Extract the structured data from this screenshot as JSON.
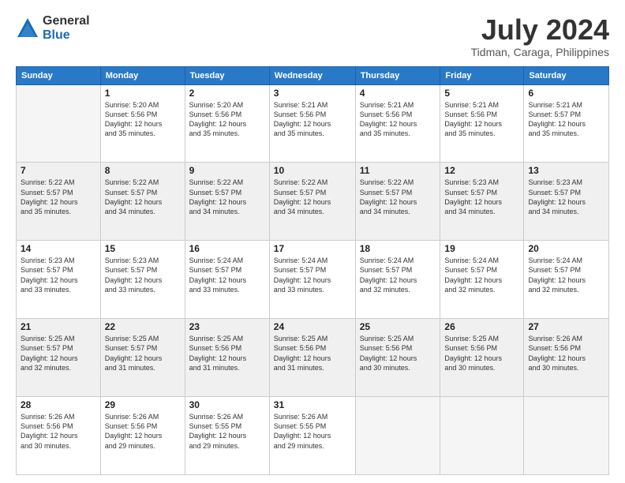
{
  "logo": {
    "general": "General",
    "blue": "Blue"
  },
  "title": "July 2024",
  "location": "Tidman, Caraga, Philippines",
  "days_of_week": [
    "Sunday",
    "Monday",
    "Tuesday",
    "Wednesday",
    "Thursday",
    "Friday",
    "Saturday"
  ],
  "weeks": [
    [
      {
        "day": "",
        "info": ""
      },
      {
        "day": "1",
        "info": "Sunrise: 5:20 AM\nSunset: 5:56 PM\nDaylight: 12 hours\nand 35 minutes."
      },
      {
        "day": "2",
        "info": "Sunrise: 5:20 AM\nSunset: 5:56 PM\nDaylight: 12 hours\nand 35 minutes."
      },
      {
        "day": "3",
        "info": "Sunrise: 5:21 AM\nSunset: 5:56 PM\nDaylight: 12 hours\nand 35 minutes."
      },
      {
        "day": "4",
        "info": "Sunrise: 5:21 AM\nSunset: 5:56 PM\nDaylight: 12 hours\nand 35 minutes."
      },
      {
        "day": "5",
        "info": "Sunrise: 5:21 AM\nSunset: 5:56 PM\nDaylight: 12 hours\nand 35 minutes."
      },
      {
        "day": "6",
        "info": "Sunrise: 5:21 AM\nSunset: 5:57 PM\nDaylight: 12 hours\nand 35 minutes."
      }
    ],
    [
      {
        "day": "7",
        "info": "Sunrise: 5:22 AM\nSunset: 5:57 PM\nDaylight: 12 hours\nand 35 minutes."
      },
      {
        "day": "8",
        "info": "Sunrise: 5:22 AM\nSunset: 5:57 PM\nDaylight: 12 hours\nand 34 minutes."
      },
      {
        "day": "9",
        "info": "Sunrise: 5:22 AM\nSunset: 5:57 PM\nDaylight: 12 hours\nand 34 minutes."
      },
      {
        "day": "10",
        "info": "Sunrise: 5:22 AM\nSunset: 5:57 PM\nDaylight: 12 hours\nand 34 minutes."
      },
      {
        "day": "11",
        "info": "Sunrise: 5:22 AM\nSunset: 5:57 PM\nDaylight: 12 hours\nand 34 minutes."
      },
      {
        "day": "12",
        "info": "Sunrise: 5:23 AM\nSunset: 5:57 PM\nDaylight: 12 hours\nand 34 minutes."
      },
      {
        "day": "13",
        "info": "Sunrise: 5:23 AM\nSunset: 5:57 PM\nDaylight: 12 hours\nand 34 minutes."
      }
    ],
    [
      {
        "day": "14",
        "info": "Sunrise: 5:23 AM\nSunset: 5:57 PM\nDaylight: 12 hours\nand 33 minutes."
      },
      {
        "day": "15",
        "info": "Sunrise: 5:23 AM\nSunset: 5:57 PM\nDaylight: 12 hours\nand 33 minutes."
      },
      {
        "day": "16",
        "info": "Sunrise: 5:24 AM\nSunset: 5:57 PM\nDaylight: 12 hours\nand 33 minutes."
      },
      {
        "day": "17",
        "info": "Sunrise: 5:24 AM\nSunset: 5:57 PM\nDaylight: 12 hours\nand 33 minutes."
      },
      {
        "day": "18",
        "info": "Sunrise: 5:24 AM\nSunset: 5:57 PM\nDaylight: 12 hours\nand 32 minutes."
      },
      {
        "day": "19",
        "info": "Sunrise: 5:24 AM\nSunset: 5:57 PM\nDaylight: 12 hours\nand 32 minutes."
      },
      {
        "day": "20",
        "info": "Sunrise: 5:24 AM\nSunset: 5:57 PM\nDaylight: 12 hours\nand 32 minutes."
      }
    ],
    [
      {
        "day": "21",
        "info": "Sunrise: 5:25 AM\nSunset: 5:57 PM\nDaylight: 12 hours\nand 32 minutes."
      },
      {
        "day": "22",
        "info": "Sunrise: 5:25 AM\nSunset: 5:57 PM\nDaylight: 12 hours\nand 31 minutes."
      },
      {
        "day": "23",
        "info": "Sunrise: 5:25 AM\nSunset: 5:56 PM\nDaylight: 12 hours\nand 31 minutes."
      },
      {
        "day": "24",
        "info": "Sunrise: 5:25 AM\nSunset: 5:56 PM\nDaylight: 12 hours\nand 31 minutes."
      },
      {
        "day": "25",
        "info": "Sunrise: 5:25 AM\nSunset: 5:56 PM\nDaylight: 12 hours\nand 30 minutes."
      },
      {
        "day": "26",
        "info": "Sunrise: 5:25 AM\nSunset: 5:56 PM\nDaylight: 12 hours\nand 30 minutes."
      },
      {
        "day": "27",
        "info": "Sunrise: 5:26 AM\nSunset: 5:56 PM\nDaylight: 12 hours\nand 30 minutes."
      }
    ],
    [
      {
        "day": "28",
        "info": "Sunrise: 5:26 AM\nSunset: 5:56 PM\nDaylight: 12 hours\nand 30 minutes."
      },
      {
        "day": "29",
        "info": "Sunrise: 5:26 AM\nSunset: 5:56 PM\nDaylight: 12 hours\nand 29 minutes."
      },
      {
        "day": "30",
        "info": "Sunrise: 5:26 AM\nSunset: 5:55 PM\nDaylight: 12 hours\nand 29 minutes."
      },
      {
        "day": "31",
        "info": "Sunrise: 5:26 AM\nSunset: 5:55 PM\nDaylight: 12 hours\nand 29 minutes."
      },
      {
        "day": "",
        "info": ""
      },
      {
        "day": "",
        "info": ""
      },
      {
        "day": "",
        "info": ""
      }
    ]
  ]
}
